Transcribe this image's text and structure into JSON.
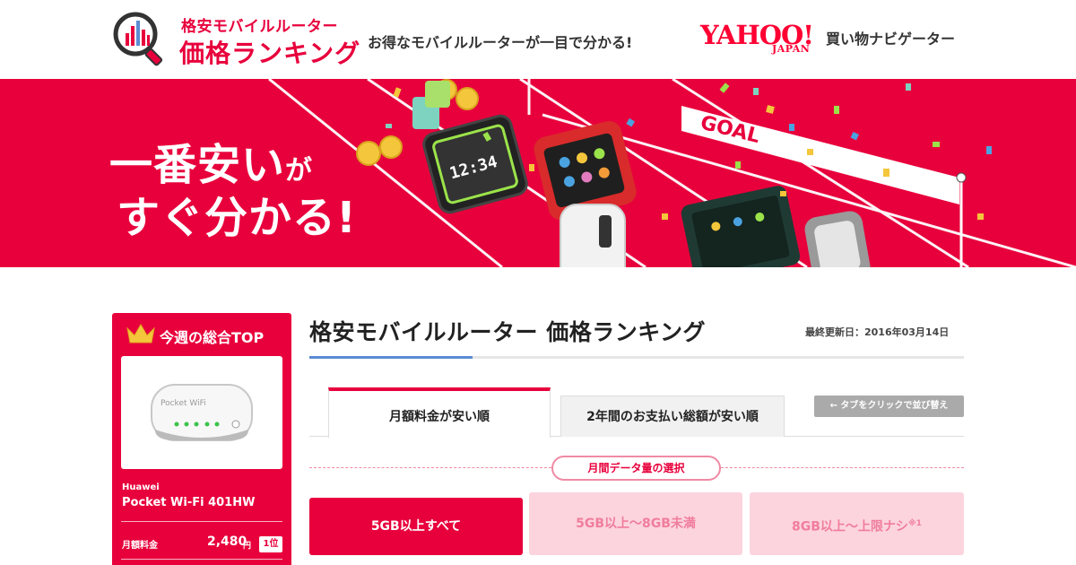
{
  "header": {
    "logo_line1": "格安モバイルルーター",
    "logo_line2": "価格ランキング",
    "tagline": "お得なモバイルルーターが一目で分かる!",
    "yahoo_logo": "YAHOO!",
    "yahoo_japan": "JAPAN",
    "yahoo_service": "買い物ナビゲーター"
  },
  "banner": {
    "headline_line1_main": "一番安い",
    "headline_line1_small": "が",
    "headline_line2": "すぐ分かる!",
    "goal_text": "GOAL",
    "device_clock": "12:34"
  },
  "sidebar": {
    "title": "今週の総合TOP",
    "device_brand_text": "Pocket WiFi",
    "maker": "Huawei",
    "product_name": "Pocket Wi-Fi 401HW",
    "price_label": "月額料金",
    "price": "2,480",
    "price_unit": "円",
    "rank": "1位"
  },
  "main": {
    "title": "格安モバイルルーター 価格ランキング",
    "updated": "最終更新日：2016年03月14日",
    "tabs": [
      {
        "label": "月額料金が安い順",
        "active": true
      },
      {
        "label": "2年間のお支払い総額が安い順",
        "active": false
      }
    ],
    "tab_hint": "← タブをクリックで並び替え",
    "data_section_label": "月間データ量の選択",
    "data_options": [
      {
        "label": "5GB以上すべて",
        "sup": "",
        "selected": true
      },
      {
        "label": "5GB以上〜8GB未満",
        "sup": "",
        "selected": false
      },
      {
        "label": "8GB以上〜上限ナシ",
        "sup": "※1",
        "selected": false
      }
    ]
  },
  "colors": {
    "brand_red": "#e8003c",
    "pink_light": "#fcd4de",
    "pink_text": "#f07d9c",
    "accent_blue": "#5b8bd4",
    "yahoo_red": "#ff0033"
  }
}
